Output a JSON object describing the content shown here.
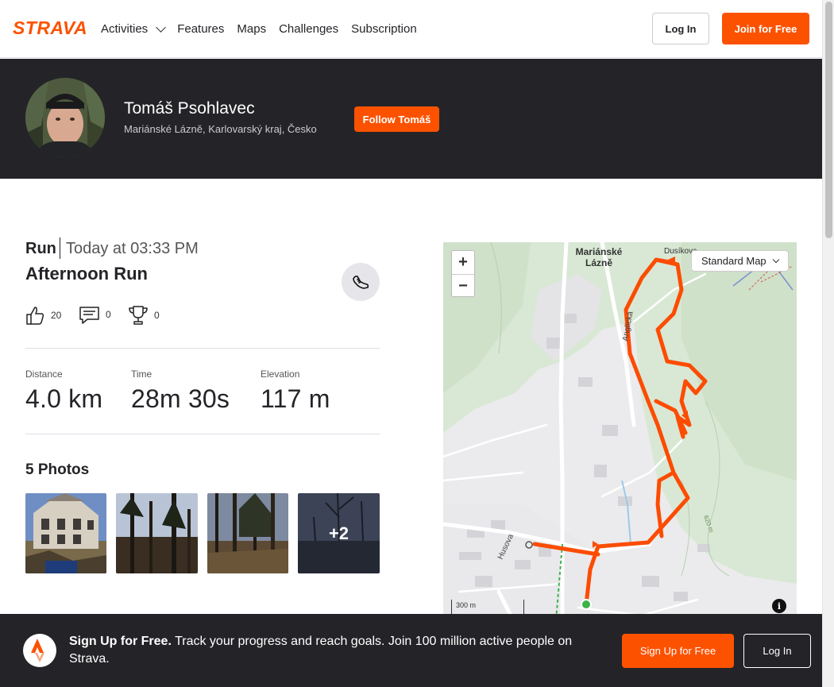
{
  "brand": {
    "name": "STRAVA",
    "accent": "#fc5200",
    "dark": "#242428"
  },
  "nav": {
    "items": [
      {
        "label": "Activities",
        "has_dropdown": true
      },
      {
        "label": "Features"
      },
      {
        "label": "Maps"
      },
      {
        "label": "Challenges"
      },
      {
        "label": "Subscription"
      }
    ],
    "login_label": "Log In",
    "join_label": "Join for Free"
  },
  "athlete": {
    "name": "Tomáš Psohlavec",
    "location": "Mariánské Lázně, Karlovarský kraj, Česko",
    "follow_label": "Follow Tomáš"
  },
  "activity": {
    "type": "Run",
    "date": "Today at 03:33 PM",
    "title": "Afternoon Run",
    "kudos": "20",
    "comments": "0",
    "achievements": "0",
    "stats": [
      {
        "label": "Distance",
        "value": "4.0 km"
      },
      {
        "label": "Time",
        "value": "28m 30s"
      },
      {
        "label": "Elevation",
        "value": "117 m"
      }
    ]
  },
  "photos": {
    "title": "5 Photos",
    "more_label": "+2"
  },
  "map": {
    "zoom_in": "+",
    "zoom_out": "−",
    "style_label": "Standard Map",
    "place_label": "Mariánské Lázně",
    "place_label_line1": "Mariánské",
    "place_label_line2": "Lázně",
    "place_dusikova": "Dusíkova",
    "street_anglicka": "Anglická",
    "street_husova": "Husova",
    "contour_label": "620 m",
    "scale_label": "300 m",
    "info_label": "i",
    "route_color": "#fc4c02"
  },
  "signup": {
    "headline": "Sign Up for Free.",
    "body": "Track your progress and reach goals. Join 100 million active people on Strava.",
    "signup_label": "Sign Up for Free",
    "login_label": "Log In"
  }
}
